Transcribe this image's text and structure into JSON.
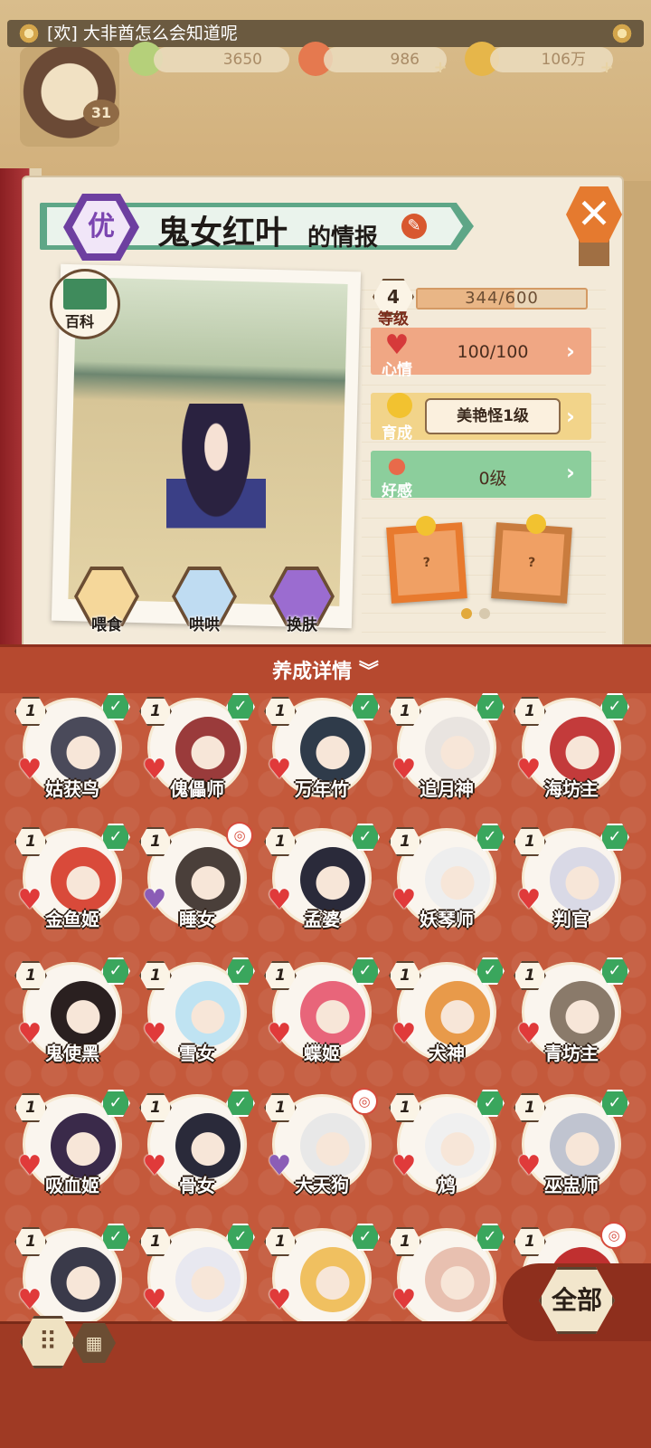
{
  "header": {
    "marquee": "[欢] 大非酋怎么会知道呢",
    "player_level": "31",
    "resources": [
      {
        "name": "tree-resource",
        "value": "3650",
        "color": "#b5d07a"
      },
      {
        "name": "heart-resource",
        "value": "986",
        "color": "#e5794f"
      },
      {
        "name": "coin-resource",
        "value": "106万",
        "color": "#e6b64a"
      }
    ]
  },
  "profile": {
    "rank": "优",
    "name": "鬼女红叶",
    "title_suffix": "的情报",
    "encyclopedia": "百科",
    "actions": [
      {
        "label": "喂食",
        "icon": "noodle-bowl-icon",
        "color": "#f5d79a"
      },
      {
        "label": "哄哄",
        "icon": "milk-carton-icon",
        "color": "#bfdcf2"
      },
      {
        "label": "换肤",
        "icon": "clothes-icon",
        "color": "#9b6cd0"
      }
    ]
  },
  "stats": {
    "level_value": "4",
    "level_label": "等级",
    "exp": "344/600",
    "exp_fraction": 0.573,
    "mood_label": "心情",
    "mood_value": "100/100",
    "nurture_label": "育成",
    "nurture_value": "美艳怪1级",
    "affinity_label": "好感",
    "affinity_value": "0级"
  },
  "cards": {
    "first": "?",
    "second": "?"
  },
  "detail_label": "养成详情",
  "grid": {
    "items": [
      {
        "name": "姑获鸟",
        "level": "1",
        "status": "✓",
        "heart": "red",
        "color": "#4a4a5a"
      },
      {
        "name": "傀儡师",
        "level": "1",
        "status": "✓",
        "heart": "red",
        "color": "#9a3b3b"
      },
      {
        "name": "万年竹",
        "level": "1",
        "status": "✓",
        "heart": "red",
        "color": "#2f3b4a"
      },
      {
        "name": "追月神",
        "level": "1",
        "status": "✓",
        "heart": "red",
        "color": "#e9e4e0"
      },
      {
        "name": "海坊主",
        "level": "1",
        "status": "✓",
        "heart": "red",
        "color": "#c33b3b"
      },
      {
        "name": "金鱼姬",
        "level": "1",
        "status": "✓",
        "heart": "red",
        "color": "#d94a3a"
      },
      {
        "name": "睡女",
        "level": "1",
        "status": "special",
        "heart": "purple",
        "color": "#4a3f3a"
      },
      {
        "name": "孟婆",
        "level": "1",
        "status": "✓",
        "heart": "red",
        "color": "#2a2a3a"
      },
      {
        "name": "妖琴师",
        "level": "1",
        "status": "✓",
        "heart": "red",
        "color": "#eeeeee"
      },
      {
        "name": "判官",
        "level": "1",
        "status": "✓",
        "heart": "red",
        "color": "#d9d9e6"
      },
      {
        "name": "鬼使黑",
        "level": "1",
        "status": "✓",
        "heart": "red",
        "color": "#2a2020"
      },
      {
        "name": "雪女",
        "level": "1",
        "status": "✓",
        "heart": "red",
        "color": "#bfe3f2"
      },
      {
        "name": "蝶姬",
        "level": "1",
        "status": "✓",
        "heart": "red",
        "color": "#e8657a"
      },
      {
        "name": "犬神",
        "level": "1",
        "status": "✓",
        "heart": "red",
        "color": "#e89a4a"
      },
      {
        "name": "青坊主",
        "level": "1",
        "status": "✓",
        "heart": "red",
        "color": "#8a7a6a"
      },
      {
        "name": "吸血姬",
        "level": "1",
        "status": "✓",
        "heart": "red",
        "color": "#3a2a4a"
      },
      {
        "name": "骨女",
        "level": "1",
        "status": "✓",
        "heart": "red",
        "color": "#2a2a3a"
      },
      {
        "name": "大天狗",
        "level": "1",
        "status": "special",
        "heart": "purple",
        "color": "#e8e8e8"
      },
      {
        "name": "鸩",
        "level": "1",
        "status": "✓",
        "heart": "red",
        "color": "#f0f0f0"
      },
      {
        "name": "巫盅师",
        "level": "1",
        "status": "✓",
        "heart": "red",
        "color": "#c0c4d0"
      },
      {
        "name": "",
        "level": "1",
        "status": "✓",
        "heart": "red",
        "color": "#3a3a4a"
      },
      {
        "name": "",
        "level": "1",
        "status": "✓",
        "heart": "red",
        "color": "#e8e8f0"
      },
      {
        "name": "",
        "level": "1",
        "status": "✓",
        "heart": "red",
        "color": "#f0c060"
      },
      {
        "name": "",
        "level": "1",
        "status": "✓",
        "heart": "red",
        "color": "#e8c0b0"
      },
      {
        "name": "",
        "level": "1",
        "status": "special",
        "heart": "red",
        "color": "#c03030"
      }
    ]
  },
  "bottom": {
    "grid_view_icon": "⠿",
    "list_view_icon": "▦",
    "all_label": "全部"
  }
}
